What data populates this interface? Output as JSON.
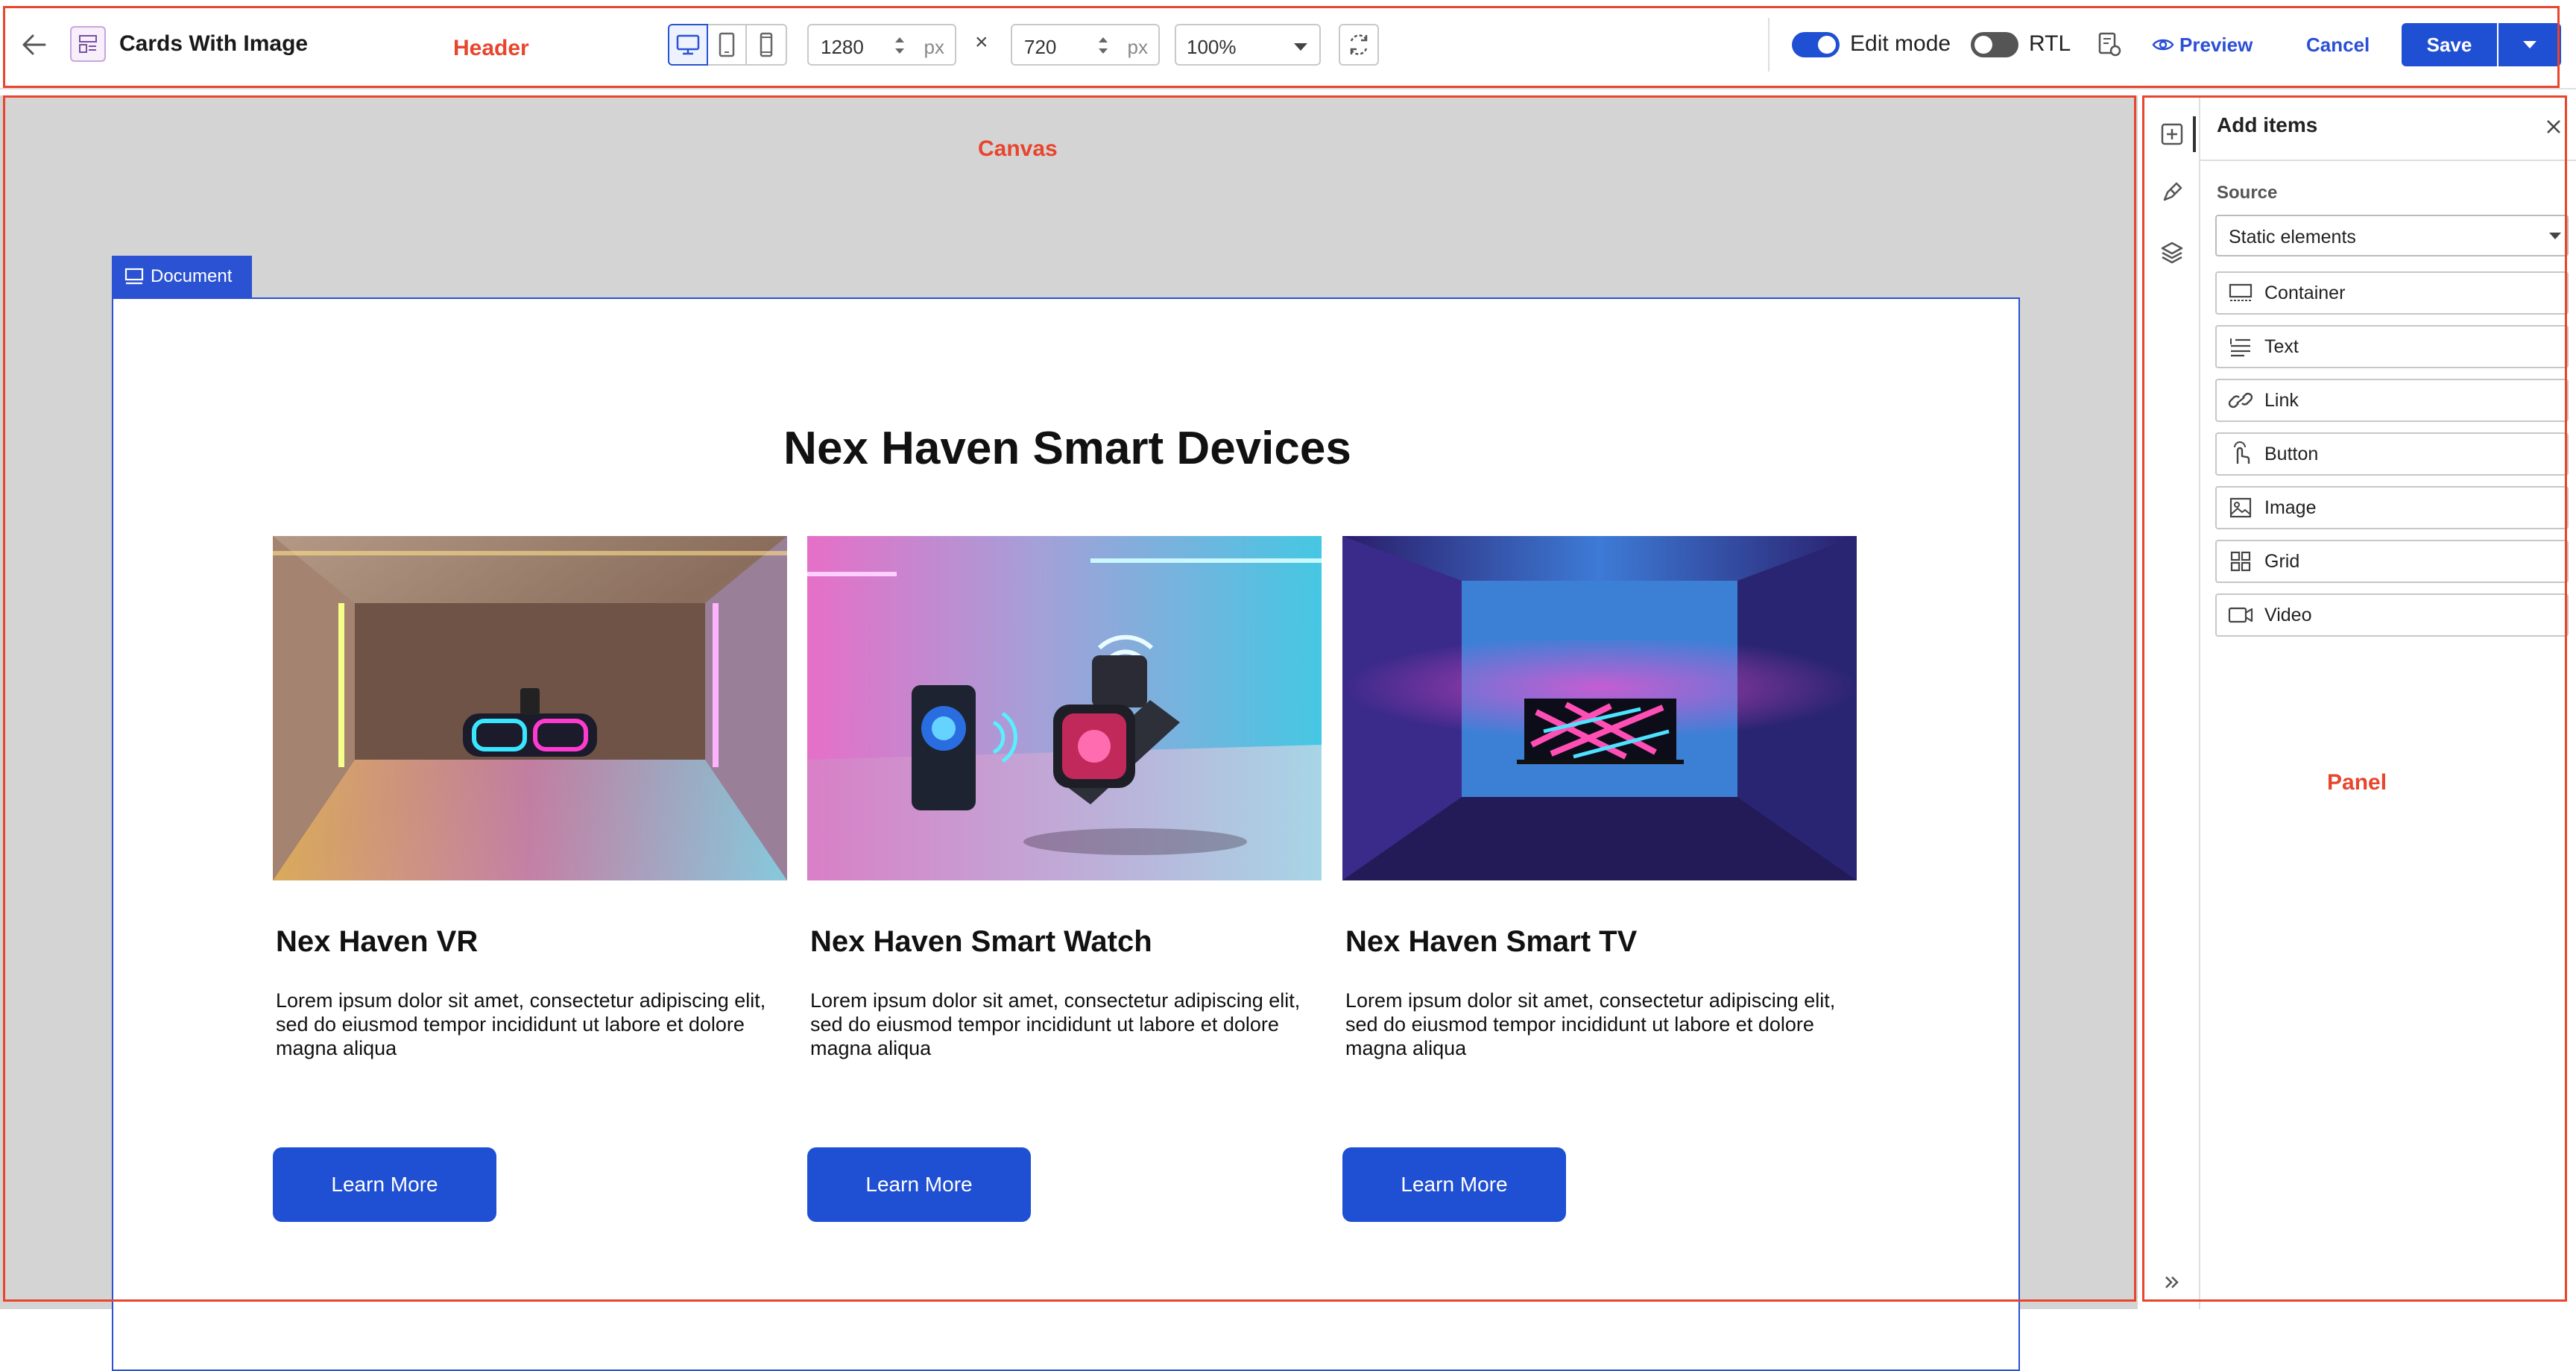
{
  "header": {
    "page_title": "Cards With Image",
    "width_value": "1280",
    "height_value": "720",
    "unit": "px",
    "times": "×",
    "zoom": "100%",
    "edit_mode_label": "Edit mode",
    "edit_mode_on": true,
    "rtl_label": "RTL",
    "rtl_on": false,
    "preview_label": "Preview",
    "cancel_label": "Cancel",
    "save_label": "Save"
  },
  "annotations": {
    "header": "Header",
    "canvas": "Canvas",
    "panel": "Panel"
  },
  "canvas": {
    "doc_tag": "Document",
    "heading": "Nex Haven Smart Devices",
    "cards": [
      {
        "title": "Nex Haven VR",
        "description": "Lorem ipsum dolor sit amet, consectetur adipiscing elit, sed do eiusmod tempor incididunt ut labore et dolore magna aliqua",
        "button": "Learn More"
      },
      {
        "title": "Nex Haven Smart Watch",
        "description": "Lorem ipsum dolor sit amet, consectetur adipiscing elit, sed do eiusmod tempor incididunt ut labore et dolore magna aliqua",
        "button": "Learn More"
      },
      {
        "title": "Nex Haven Smart TV",
        "description": "Lorem ipsum dolor sit amet, consectetur adipiscing elit, sed do eiusmod tempor incididunt ut labore et dolore magna aliqua",
        "button": "Learn More"
      }
    ]
  },
  "panel": {
    "title": "Add items",
    "source_label": "Source",
    "source_value": "Static elements",
    "items": [
      {
        "label": "Container",
        "icon": "container-icon"
      },
      {
        "label": "Text",
        "icon": "text-icon"
      },
      {
        "label": "Link",
        "icon": "link-icon"
      },
      {
        "label": "Button",
        "icon": "button-icon"
      },
      {
        "label": "Image",
        "icon": "image-icon"
      },
      {
        "label": "Grid",
        "icon": "grid-icon"
      },
      {
        "label": "Video",
        "icon": "video-icon"
      }
    ]
  },
  "colors": {
    "accent": "#1f4fd2",
    "annotation": "#e8452c",
    "canvas_bg": "#d4d4d4"
  }
}
